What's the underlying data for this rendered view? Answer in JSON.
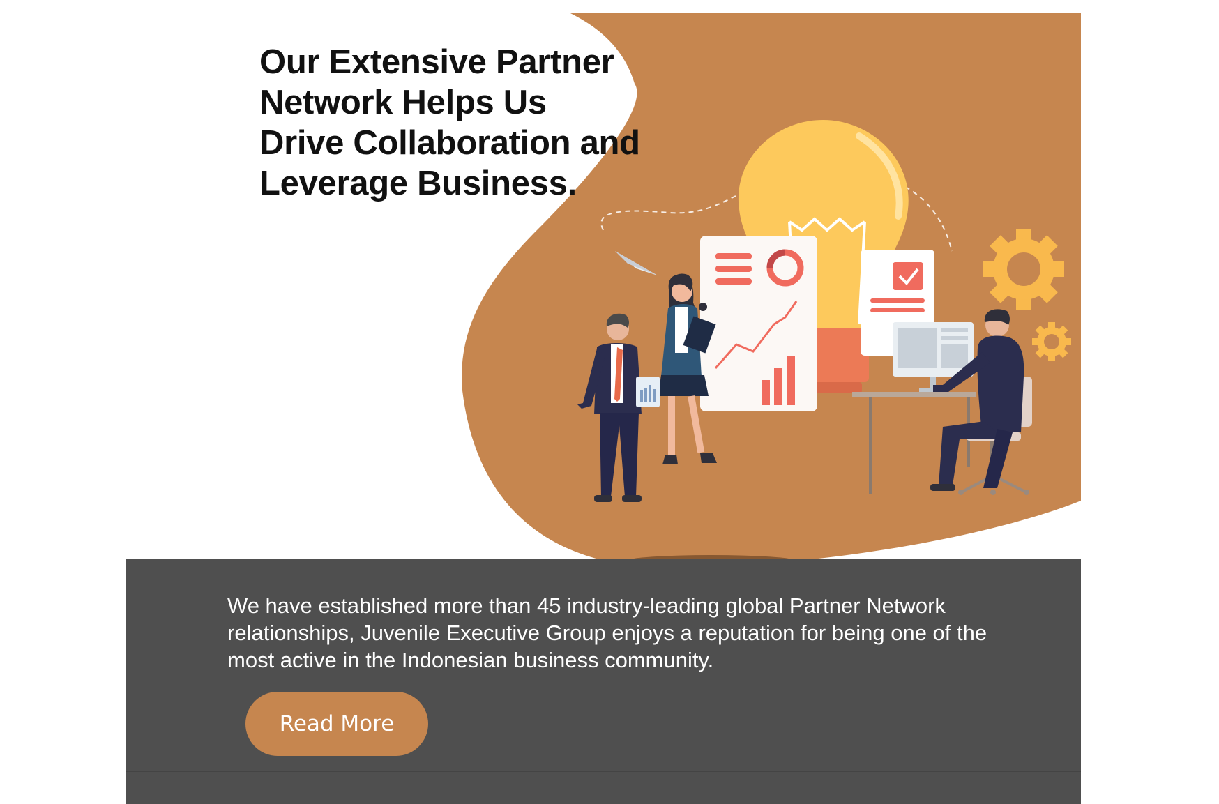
{
  "hero": {
    "headline_lines": [
      "Our Extensive Partner",
      "Network Helps Us",
      "Drive Collaboration and",
      "Leverage Business."
    ],
    "illustration": "partner-network-collaboration-illustration"
  },
  "info": {
    "description": "We have established more than 45 industry-leading global Partner Network relationships, Juvenile Executive Group enjoys a reputation for being one of the most active in the Indonesian business community.",
    "cta_label": "Read More"
  },
  "colors": {
    "accent": "#c6864f",
    "panel": "#4f4f4f",
    "bulb": "#fdc95c",
    "gear": "#f9b94d",
    "coral": "#f06b5e",
    "suit": "#2b2d4e"
  }
}
